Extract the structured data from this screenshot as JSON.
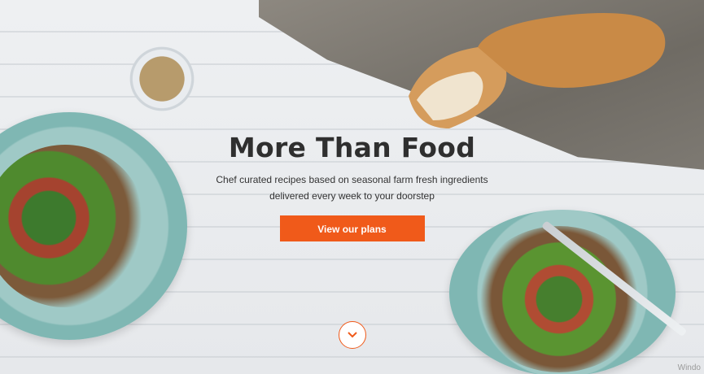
{
  "hero": {
    "title": "More Than Food",
    "subtitle_line1": "Chef curated recipes based on seasonal farm fresh ingredients",
    "subtitle_line2": "delivered every week to your doorstep",
    "cta_label": "View our plans",
    "scroll_icon": "chevron-down-icon",
    "watermark": "Windo"
  },
  "colors": {
    "accent": "#f05a1a",
    "title": "#2f2f2f",
    "plate": "#8cbdb9",
    "wood": "#eceef0"
  }
}
